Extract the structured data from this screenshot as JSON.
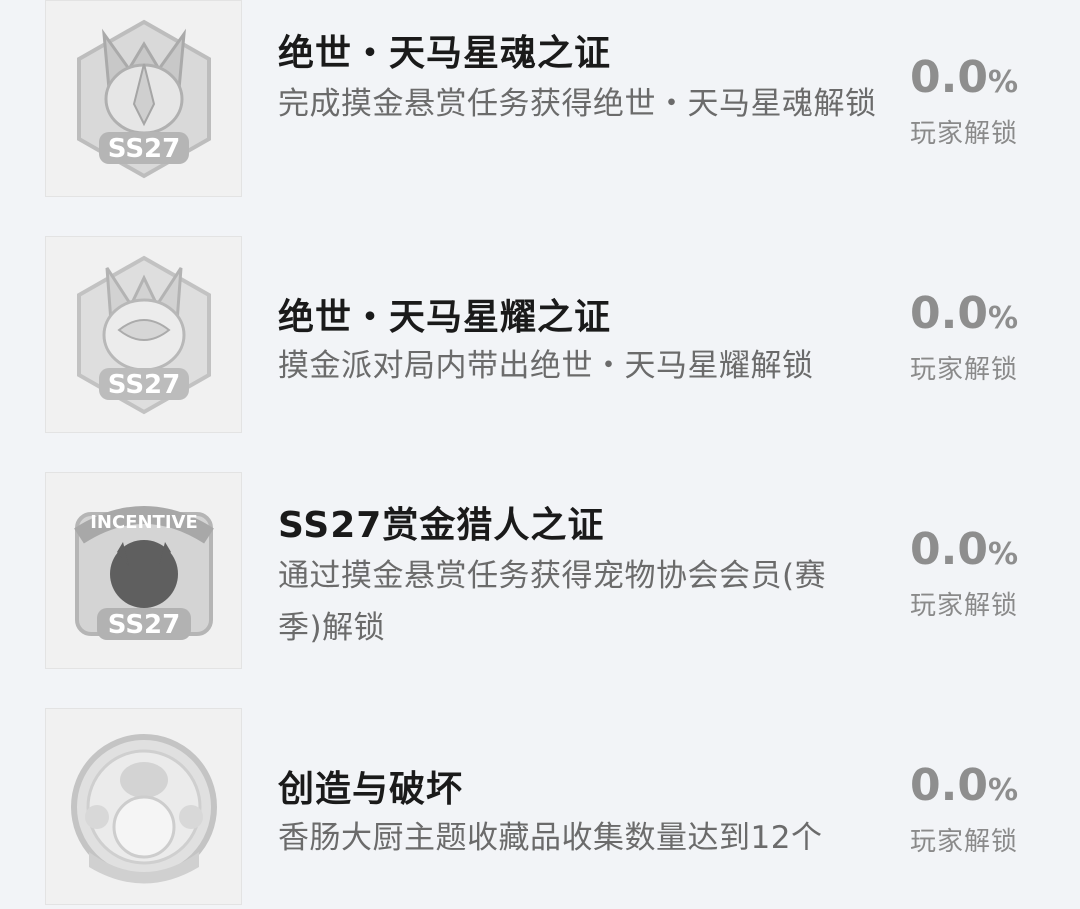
{
  "achievements": [
    {
      "badge_icon": "pegasus-soul-badge-icon",
      "badge_text": "SS27",
      "title": "绝世・天马星魂之证",
      "description": "完成摸金悬赏任务获得绝世・天马星魂解锁",
      "percent": "0.0",
      "percent_unit": "%",
      "unlock_label": "玩家解锁"
    },
    {
      "badge_icon": "pegasus-glory-badge-icon",
      "badge_text": "SS27",
      "title": "绝世・天马星耀之证",
      "description": "摸金派对局内带出绝世・天马星耀解锁",
      "percent": "0.0",
      "percent_unit": "%",
      "unlock_label": "玩家解锁"
    },
    {
      "badge_icon": "bounty-hunter-badge-icon",
      "badge_text": "SS27",
      "badge_banner": "INCENTIVE",
      "title": "SS27赏金猎人之证",
      "description": "通过摸金悬赏任务获得宠物协会会员(赛季)解锁",
      "percent": "0.0",
      "percent_unit": "%",
      "unlock_label": "玩家解锁"
    },
    {
      "badge_icon": "chef-creation-badge-icon",
      "title": "创造与破坏",
      "description": "香肠大厨主题收藏品收集数量达到12个",
      "percent": "0.0",
      "percent_unit": "%",
      "unlock_label": "玩家解锁"
    }
  ],
  "colors": {
    "background": "#f2f4f7",
    "title": "#1a1a1a",
    "description": "#6b6b6b",
    "stat": "#8e8e8e"
  }
}
